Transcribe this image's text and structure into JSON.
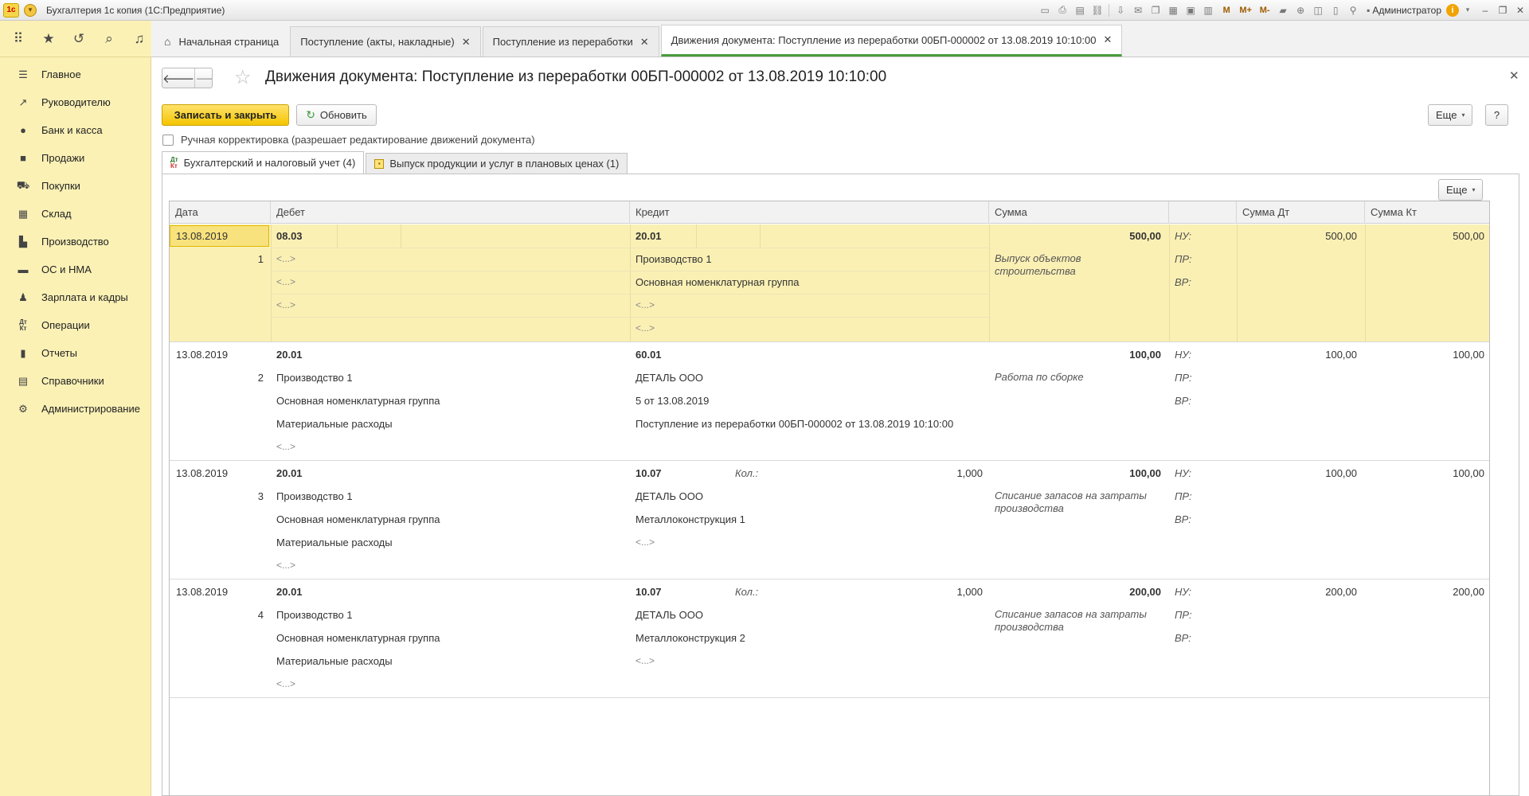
{
  "window": {
    "title": "Бухгалтерия 1с копия  (1С:Предприятие)",
    "user": "Администратор",
    "logo": "1с",
    "tools": [
      "M",
      "M+",
      "M-"
    ]
  },
  "tabs": [
    {
      "label": "Начальная страница"
    },
    {
      "label": "Поступление (акты, накладные)"
    },
    {
      "label": "Поступление из переработки"
    },
    {
      "label": "Движения документа: Поступление из переработки 00БП-000002 от 13.08.2019 10:10:00"
    }
  ],
  "sidebar": {
    "items": [
      {
        "label": "Главное",
        "icon": "menu-icon"
      },
      {
        "label": "Руководителю",
        "icon": "chart-trend-icon"
      },
      {
        "label": "Банк и касса",
        "icon": "coin-icon"
      },
      {
        "label": "Продажи",
        "icon": "bag-icon"
      },
      {
        "label": "Покупки",
        "icon": "cart-icon"
      },
      {
        "label": "Склад",
        "icon": "grid-icon"
      },
      {
        "label": "Производство",
        "icon": "factory-icon"
      },
      {
        "label": "ОС и НМА",
        "icon": "truck-icon"
      },
      {
        "label": "Зарплата и кадры",
        "icon": "person-icon"
      },
      {
        "label": "Операции",
        "icon": "dt-kt-icon"
      },
      {
        "label": "Отчеты",
        "icon": "bar-chart-icon"
      },
      {
        "label": "Справочники",
        "icon": "book-icon"
      },
      {
        "label": "Администрирование",
        "icon": "gear-icon"
      }
    ]
  },
  "doc": {
    "title": "Движения документа: Поступление из переработки 00БП-000002 от 13.08.2019 10:10:00",
    "save_close": "Записать и закрыть",
    "refresh": "Обновить",
    "more": "Еще",
    "help": "?",
    "manual": "Ручная корректировка (разрешает редактирование движений документа)",
    "subtabs": [
      "Бухгалтерский и налоговый учет (4)",
      "Выпуск продукции и услуг в плановых ценах (1)"
    ],
    "dt": "Дт",
    "kt": "Кт"
  },
  "table": {
    "headers": {
      "date": "Дата",
      "debit": "Дебет",
      "credit": "Кредит",
      "sum": "Сумма",
      "sum_dt": "Сумма Дт",
      "sum_kt": "Сумма Кт"
    },
    "labels": {
      "nu": "НУ:",
      "pr": "ПР:",
      "vr": "ВР:",
      "kol": "Кол.:"
    },
    "rows": [
      {
        "date": "13.08.2019",
        "num": "1",
        "debit": "08.03",
        "debit_sub": [
          "<...>",
          "<...>",
          "<...>"
        ],
        "credit": "20.01",
        "credit_sub": [
          "Производство 1",
          "Основная номенклатурная группа",
          "<...>",
          "<...>"
        ],
        "qty": "",
        "sum": "500,00",
        "content": "Выпуск объектов строительства",
        "sum_dt": "500,00",
        "sum_kt": "500,00"
      },
      {
        "date": "13.08.2019",
        "num": "2",
        "debit": "20.01",
        "debit_sub": [
          "Производство 1",
          "Основная номенклатурная группа",
          "Материальные расходы",
          "<...>"
        ],
        "credit": "60.01",
        "credit_sub": [
          "ДЕТАЛЬ ООО",
          "5 от 13.08.2019",
          "Поступление из переработки 00БП-000002 от 13.08.2019 10:10:00"
        ],
        "qty": "",
        "sum": "100,00",
        "content": "Работа по сборке",
        "sum_dt": "100,00",
        "sum_kt": "100,00"
      },
      {
        "date": "13.08.2019",
        "num": "3",
        "debit": "20.01",
        "debit_sub": [
          "Производство 1",
          "Основная номенклатурная группа",
          "Материальные расходы",
          "<...>"
        ],
        "credit": "10.07",
        "credit_sub": [
          "ДЕТАЛЬ ООО",
          "Металлоконструкция 1",
          "<...>"
        ],
        "qty": "1,000",
        "sum": "100,00",
        "content": "Списание запасов на затраты производства",
        "sum_dt": "100,00",
        "sum_kt": "100,00"
      },
      {
        "date": "13.08.2019",
        "num": "4",
        "debit": "20.01",
        "debit_sub": [
          "Производство 1",
          "Основная номенклатурная группа",
          "Материальные расходы",
          "<...>"
        ],
        "credit": "10.07",
        "credit_sub": [
          "ДЕТАЛЬ ООО",
          "Металлоконструкция 2",
          "<...>"
        ],
        "qty": "1,000",
        "sum": "200,00",
        "content": "Списание запасов на затраты производства",
        "sum_dt": "200,00",
        "sum_kt": "200,00"
      }
    ]
  }
}
